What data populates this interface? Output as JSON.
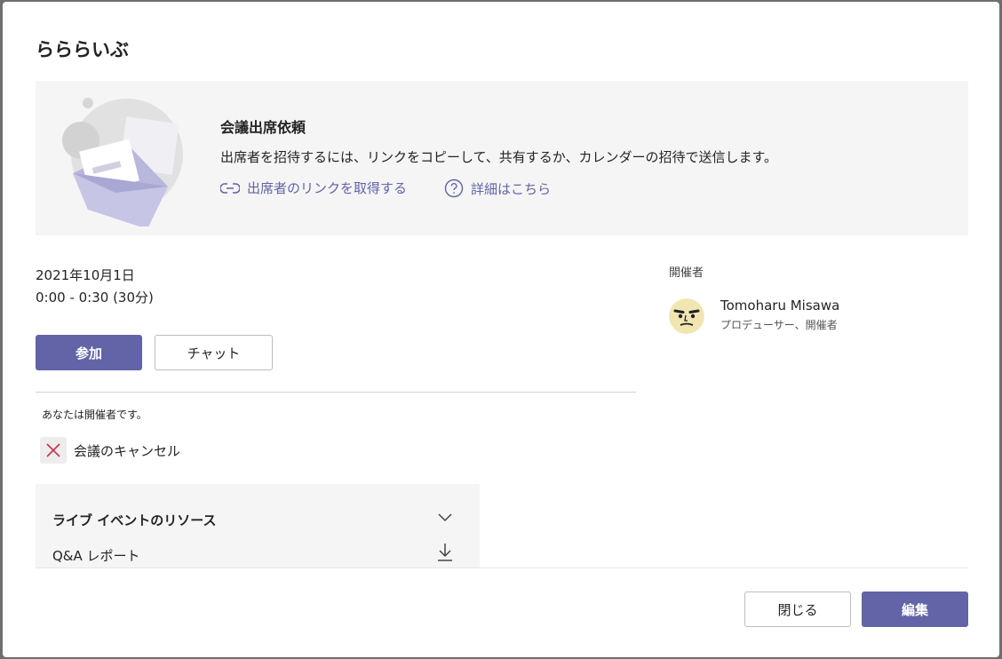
{
  "dialog": {
    "title": "らららいぶ"
  },
  "banner": {
    "heading": "会議出席依頼",
    "description": "出席者を招待するには、リンクをコピーして、共有するか、カレンダーの招待で送信します。",
    "get_link_label": "出席者のリンクを取得する",
    "details_label": "詳細はこちら"
  },
  "meeting": {
    "date": "2021年10月1日",
    "time": "0:00 - 0:30 (30分)",
    "join_label": "参加",
    "chat_label": "チャット",
    "organizer_note": "あなたは開催者です。",
    "cancel_label": "会議のキャンセル"
  },
  "resources": {
    "title": "ライブ イベントのリソース",
    "items": [
      {
        "label": "Q&A レポート"
      }
    ]
  },
  "organizer": {
    "section_label": "開催者",
    "name": "Tomoharu Misawa",
    "role": "プロデューサー、開催者"
  },
  "footer": {
    "close_label": "閉じる",
    "edit_label": "編集"
  },
  "colors": {
    "accent": "#6264a7",
    "cancel_icon": "#c4314b",
    "banner_bg": "#f5f5f5"
  }
}
